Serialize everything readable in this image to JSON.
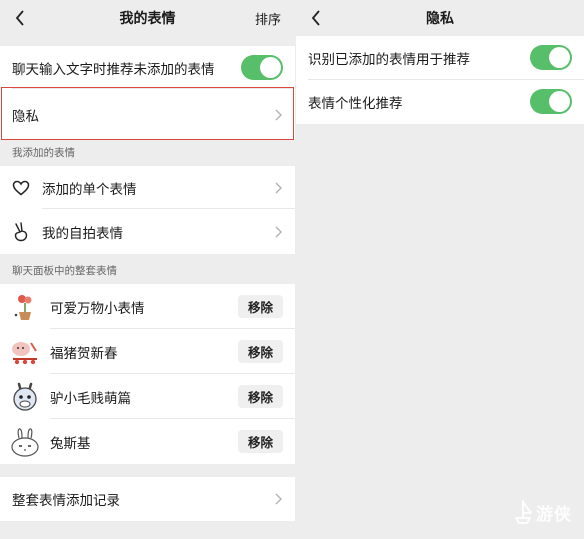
{
  "left": {
    "header": {
      "title": "我的表情",
      "action": "排序"
    },
    "recommend_row": {
      "label": "聊天输入文字时推荐未添加的表情",
      "enabled": true
    },
    "privacy_row": {
      "label": "隐私"
    },
    "section_added": {
      "title": "我添加的表情",
      "items": [
        {
          "label": "添加的单个表情",
          "icon": "heart-outline-icon"
        },
        {
          "label": "我的自拍表情",
          "icon": "hand-gesture-icon"
        }
      ]
    },
    "section_sets": {
      "title": "聊天面板中的整套表情",
      "remove_label": "移除",
      "items": [
        {
          "label": "可爱万物小表情",
          "icon": "flower-pot-sticker-icon"
        },
        {
          "label": "福猪贺新春",
          "icon": "pig-sticker-icon"
        },
        {
          "label": "驴小毛贱萌篇",
          "icon": "donkey-sticker-icon"
        },
        {
          "label": "兔斯基",
          "icon": "rabbit-sticker-icon"
        }
      ]
    },
    "history_row": {
      "label": "整套表情添加记录"
    }
  },
  "right": {
    "header": {
      "title": "隐私"
    },
    "rows": [
      {
        "label": "识别已添加的表情用于推荐",
        "enabled": true
      },
      {
        "label": "表情个性化推荐",
        "enabled": true
      }
    ]
  },
  "watermark": {
    "text": "游侠",
    "icon": "ship-logo-icon"
  },
  "colors": {
    "toggle_on": "#57be6a",
    "highlight": "#d9473f",
    "background": "#ededed"
  }
}
